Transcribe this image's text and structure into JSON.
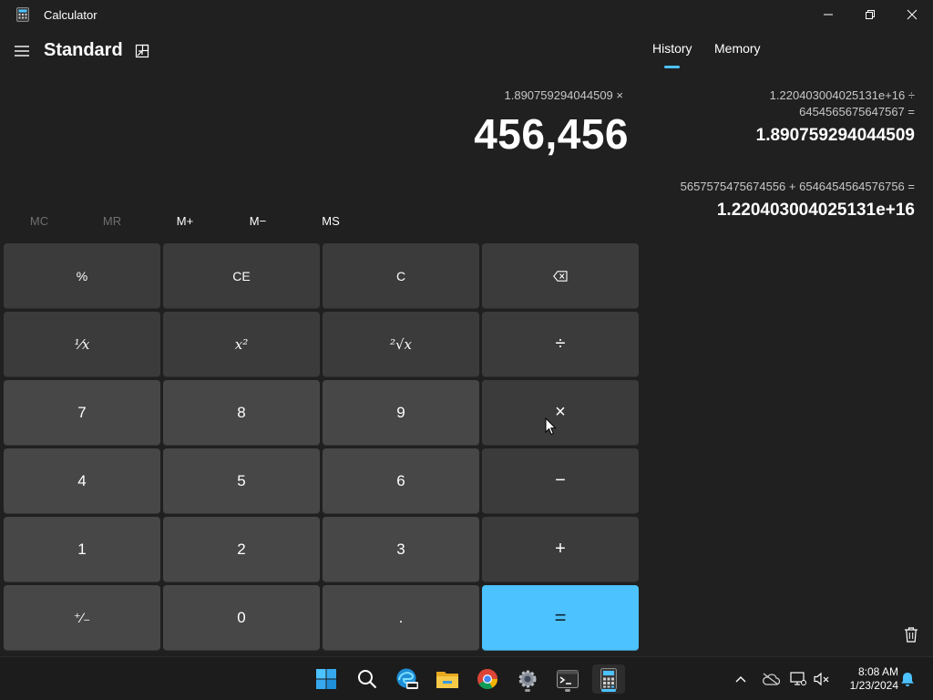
{
  "window": {
    "title": "Calculator",
    "icons": {
      "app": "calculator-icon",
      "minimize": "minimize-icon",
      "maximize": "restore-icon",
      "close": "close-icon"
    }
  },
  "header": {
    "mode": "Standard",
    "menu_icon": "hamburger-icon",
    "keep_on_top_icon": "keep-on-top-icon"
  },
  "display": {
    "expression": "1.890759294044509 ×",
    "value": "456,456"
  },
  "memory": {
    "buttons": [
      {
        "label": "MC",
        "enabled": false
      },
      {
        "label": "MR",
        "enabled": false
      },
      {
        "label": "M+",
        "enabled": true
      },
      {
        "label": "M−",
        "enabled": true
      },
      {
        "label": "MS",
        "enabled": true
      }
    ]
  },
  "keypad": {
    "percent": "%",
    "clear_entry": "CE",
    "clear": "C",
    "backspace_icon": "backspace-icon",
    "reciprocal": "⅟x",
    "square": "x²",
    "square_root": "²√x",
    "divide": "÷",
    "multiply": "×",
    "minus": "−",
    "plus": "+",
    "negate": "⁺∕₋",
    "decimal": ".",
    "equals": "=",
    "digits": {
      "0": "0",
      "1": "1",
      "2": "2",
      "3": "3",
      "4": "4",
      "5": "5",
      "6": "6",
      "7": "7",
      "8": "8",
      "9": "9"
    }
  },
  "panel": {
    "tabs": [
      {
        "label": "History",
        "active": true
      },
      {
        "label": "Memory",
        "active": false
      }
    ],
    "history": [
      {
        "expr_line1": "1.220403004025131e+16   ÷",
        "expr_line2": "6454565675647567 =",
        "result": "1.890759294044509"
      },
      {
        "expr_line1": "5657575475674556   +   6546454564576756 =",
        "result": "1.220403004025131e+16"
      }
    ],
    "delete_icon": "trash-icon"
  },
  "taskbar": {
    "apps": [
      "windows-start-icon",
      "search-icon",
      "edge-beta-icon",
      "file-explorer-icon",
      "chrome-icon",
      "settings-icon",
      "terminal-icon",
      "calculator-icon"
    ],
    "tray": [
      "chevron-up-icon",
      "cloud-offline-icon",
      "network-icon",
      "volume-muted-icon"
    ],
    "time": "8:08 AM",
    "date": "1/23/2024",
    "notification_icon": "bell-icon"
  },
  "colors": {
    "background": "#202020",
    "accent": "#4cc2ff",
    "key_num": "#474747",
    "key_func": "#3b3b3b"
  }
}
